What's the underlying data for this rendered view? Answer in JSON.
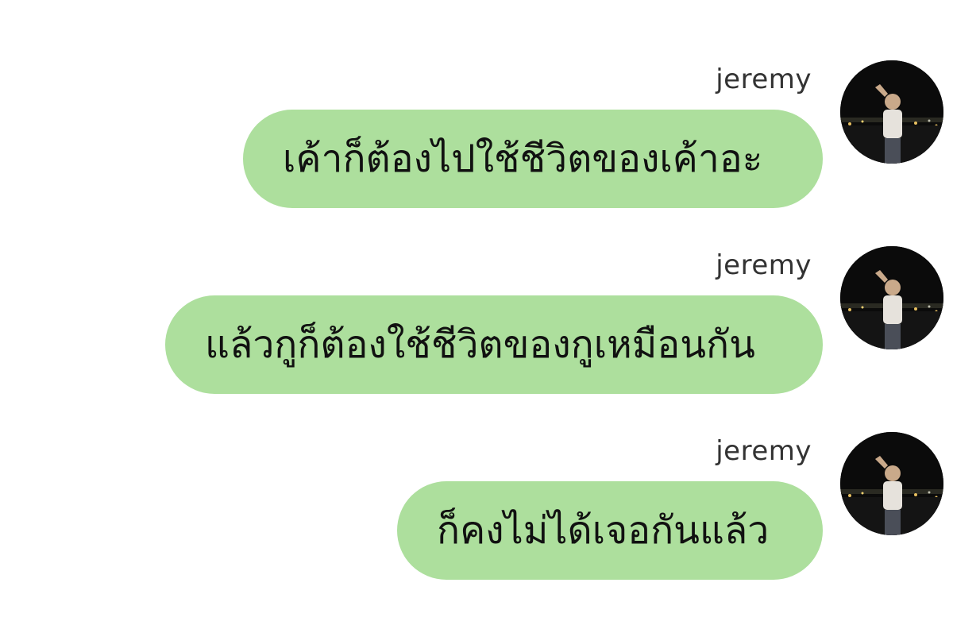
{
  "chat": {
    "messages": [
      {
        "sender": "jeremy",
        "text": "เค้าก็ต้องไปใช้ชีวิตของเค้าอะ"
      },
      {
        "sender": "jeremy",
        "text": "แล้วกูก็ต้องใช้ชีวิตของกูเหมือนกัน"
      },
      {
        "sender": "jeremy",
        "text": "ก็คงไม่ได้เจอกันแล้ว"
      }
    ]
  },
  "colors": {
    "bubble": "#addf9d",
    "background": "#ffffff",
    "avatar_background": "#0a0a0a"
  }
}
